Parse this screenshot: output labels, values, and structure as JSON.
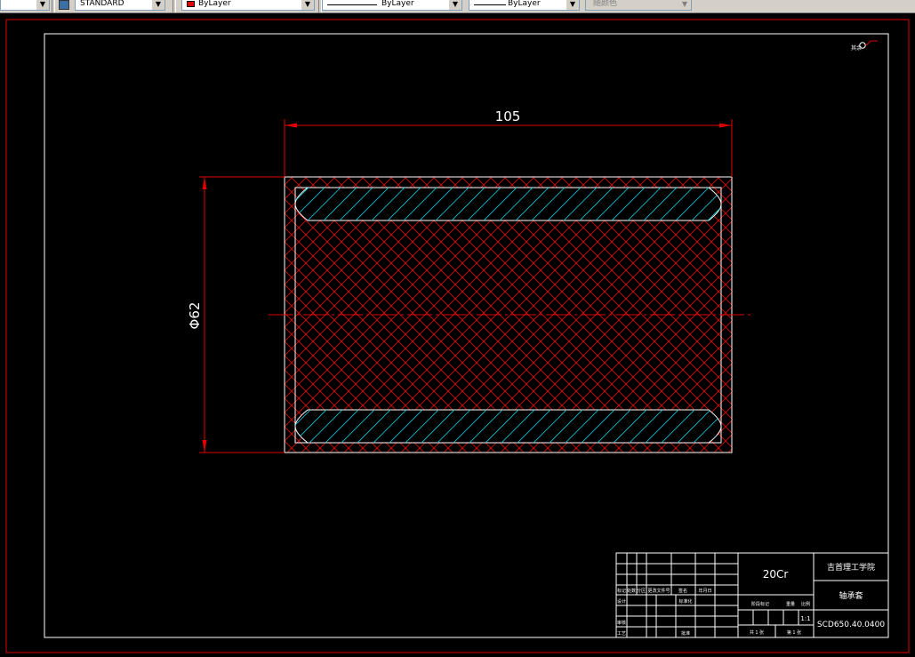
{
  "toolbar": {
    "text_style": "STANDARD",
    "color": "ByLayer",
    "linetype": "ByLayer",
    "lineweight": "ByLayer",
    "plot_style": "随颜色",
    "color_swatch": "#e00000"
  },
  "drawing": {
    "length_dim": "105",
    "diameter_dim": "Φ62",
    "roughness_symbol": "其余"
  },
  "title_block": {
    "material": "20Cr",
    "school": "吉首理工学院",
    "part_name": "轴承套",
    "drawing_no": "SCD650.40.0400",
    "scale": "1:1",
    "revision_headers": [
      "标记",
      "处数",
      "分区",
      "更改文件号",
      "签名",
      "年月日"
    ],
    "role_rows": [
      "设计",
      "审核",
      "工艺"
    ],
    "col_headers": [
      "标准化",
      "批准"
    ],
    "stage_labels": [
      "阶段标记",
      "重量",
      "比例"
    ],
    "sheet_labels": [
      "共 1 张",
      "第 1 张"
    ]
  }
}
